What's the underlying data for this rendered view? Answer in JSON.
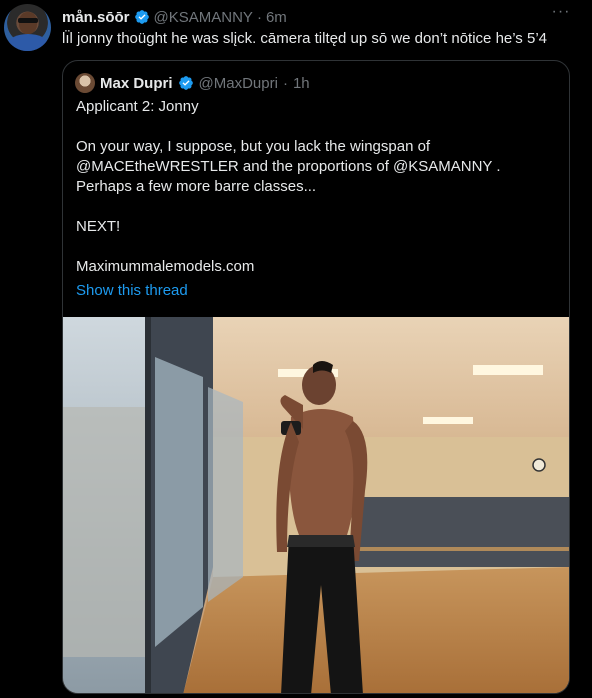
{
  "tweet": {
    "author_name": "mån.sōōr",
    "author_handle": "@KSAMANNY",
    "separator": "·",
    "time": "6m",
    "more_label": "···",
    "text": "lı̈l jonny thoüght he was slįck. cāmera tiltęd up sō we don’t nōtice he’s 5’4"
  },
  "quote": {
    "author_name": "Max Dupri",
    "author_handle": "@MaxDupri",
    "separator": "·",
    "time": "1h",
    "lines": [
      "Applicant 2: Jonny",
      "",
      "On your way, I suppose, but you lack the wingspan of",
      "@MACEtheWRESTLER and the proportions of @KSAMANNY .",
      "Perhaps a few more barre classes...",
      "",
      "NEXT!",
      "",
      "Maximummalemodels.com"
    ],
    "show_thread": "Show this thread"
  },
  "colors": {
    "background": "#000000",
    "text": "#e7e9ea",
    "muted": "#71767b",
    "link": "#1d9bf0",
    "border": "#2f3336",
    "verified": "#1d9bf0"
  },
  "icons": {
    "verified": "verified-badge-icon",
    "more": "more-options-icon"
  }
}
